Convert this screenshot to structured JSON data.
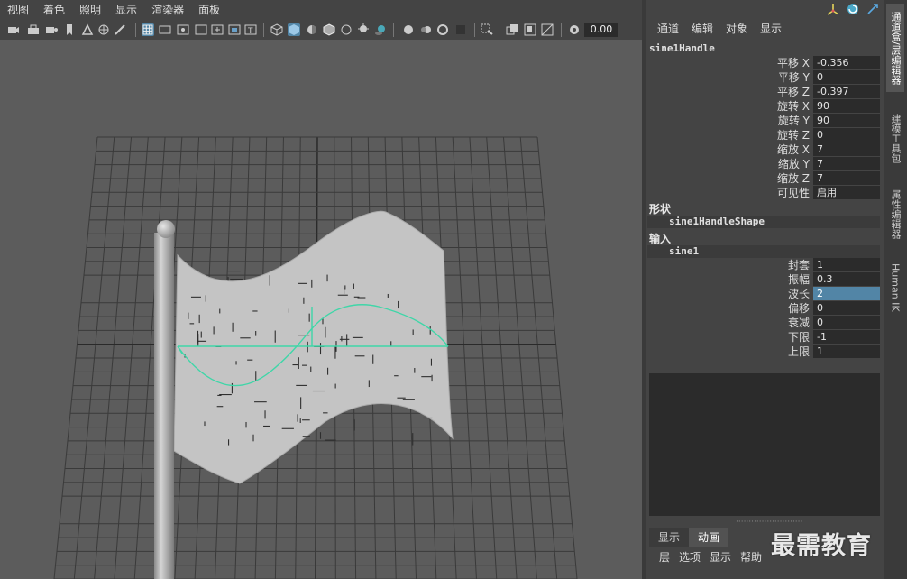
{
  "viewport": {
    "menu": [
      "视图",
      "着色",
      "照明",
      "显示",
      "渲染器",
      "面板"
    ],
    "current_time": "0.00"
  },
  "channel_box": {
    "menu": [
      "通道",
      "编辑",
      "对象",
      "显示"
    ],
    "object_name": "sine1Handle",
    "transform_attrs": [
      {
        "label": "平移 X",
        "value": "-0.356"
      },
      {
        "label": "平移 Y",
        "value": "0"
      },
      {
        "label": "平移 Z",
        "value": "-0.397"
      },
      {
        "label": "旋转 X",
        "value": "90"
      },
      {
        "label": "旋转 Y",
        "value": "90"
      },
      {
        "label": "旋转 Z",
        "value": "0"
      },
      {
        "label": "缩放 X",
        "value": "7"
      },
      {
        "label": "缩放 Y",
        "value": "7"
      },
      {
        "label": "缩放 Z",
        "value": "7"
      },
      {
        "label": "可见性",
        "value": "启用"
      }
    ],
    "shapes_header": "形状",
    "shape_name": "sine1HandleShape",
    "inputs_header": "输入",
    "input_name": "sine1",
    "input_attrs": [
      {
        "label": "封套",
        "value": "1",
        "highlight": false
      },
      {
        "label": "振幅",
        "value": "0.3",
        "highlight": false
      },
      {
        "label": "波长",
        "value": "2",
        "highlight": true
      },
      {
        "label": "偏移",
        "value": "0",
        "highlight": false
      },
      {
        "label": "衰减",
        "value": "0",
        "highlight": false
      },
      {
        "label": "下限",
        "value": "-1",
        "highlight": false
      },
      {
        "label": "上限",
        "value": "1",
        "highlight": false
      }
    ]
  },
  "layer_editor": {
    "tabs": [
      {
        "label": "显示",
        "active": false
      },
      {
        "label": "动画",
        "active": true
      }
    ],
    "menu": [
      "层",
      "选项",
      "显示",
      "帮助"
    ]
  },
  "side_tabs": [
    {
      "label": "通道盒/层编辑器",
      "active": true
    },
    {
      "label": "建模工具包",
      "active": false
    },
    {
      "label": "属性编辑器",
      "active": false
    },
    {
      "label": "Human IK",
      "active": false
    }
  ],
  "watermark": "最需教育",
  "colors": {
    "accent": "#5285a6",
    "deformer_handle": "#3fd6a8",
    "flag": "#c4c4c4",
    "grid": "#3a3a3a"
  }
}
